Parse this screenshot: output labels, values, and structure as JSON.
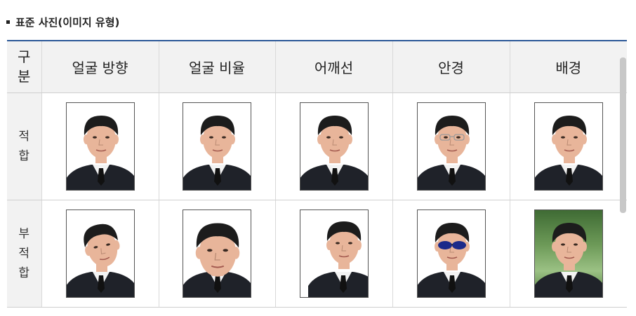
{
  "section": {
    "title": "표준 사진(이미지 유형)"
  },
  "table": {
    "corner_label": "구분",
    "columns": [
      "얼굴 방향",
      "얼굴 비율",
      "어깨선",
      "안경",
      "배경"
    ],
    "rows": [
      {
        "label": "적합"
      },
      {
        "label": "부적합"
      }
    ]
  },
  "colors": {
    "header_border": "#2b5797",
    "header_bg": "#f2f2f2"
  }
}
